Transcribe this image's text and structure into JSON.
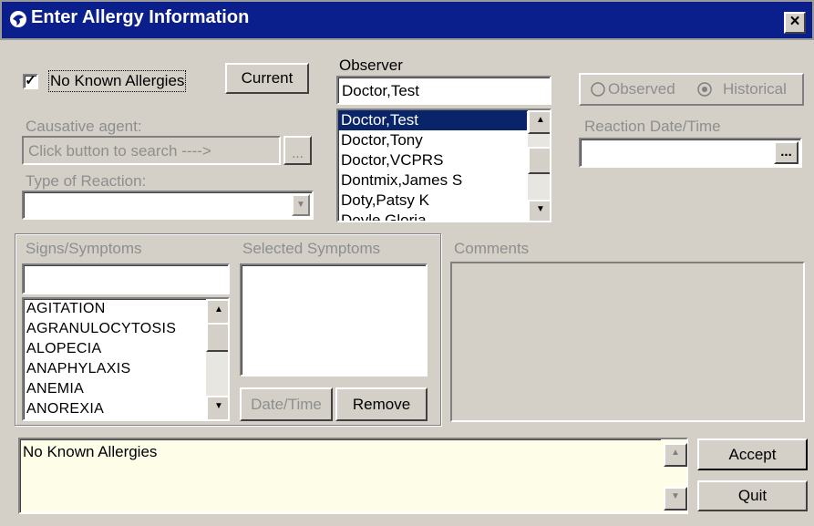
{
  "window": {
    "title": "Enter Allergy Information",
    "close_glyph": "×"
  },
  "nka": {
    "checked_glyph": "✓",
    "label": "No Known Allergies"
  },
  "current_button": "Current",
  "observer": {
    "label": "Observer",
    "value": "Doctor,Test",
    "items": [
      "Doctor,Test",
      "Doctor,Tony",
      "Doctor,VCPRS",
      "Dontmix,James S",
      "Doty,Patsy K",
      "Doyle,Gloria"
    ],
    "selected_index": 0
  },
  "observed_radio": "Observed",
  "historical_radio": "Historical",
  "causative": {
    "label": "Causative agent:",
    "placeholder": "Click button to search ---->",
    "button": "..."
  },
  "reaction_type": {
    "label": "Type of Reaction:",
    "value": ""
  },
  "reaction_datetime": {
    "label": "Reaction Date/Time",
    "value": "",
    "button": "..."
  },
  "signs": {
    "label": "Signs/Symptoms",
    "search_value": "",
    "items": [
      "AGITATION",
      "AGRANULOCYTOSIS",
      "ALOPECIA",
      "ANAPHYLAXIS",
      "ANEMIA",
      "ANOREXIA"
    ]
  },
  "selected_symptoms": {
    "label": "Selected Symptoms",
    "items": []
  },
  "datetime_button": "Date/Time",
  "remove_button": "Remove",
  "comments": {
    "label": "Comments",
    "value": ""
  },
  "summary_text": "No Known Allergies",
  "accept_button": "Accept",
  "quit_button": "Quit"
}
